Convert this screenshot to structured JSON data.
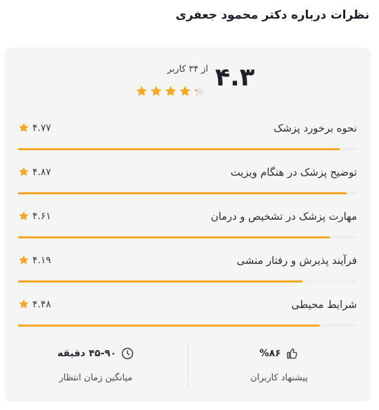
{
  "header": {
    "title": "نظرات درباره دکتر محمود جعفری"
  },
  "summary": {
    "average": "۴.۳",
    "count_text": "از ۳۴ کاربر",
    "rating_fraction": 0.86
  },
  "criteria": [
    {
      "label": "نحوه برخورد پزشک",
      "score": "۴.۷۷",
      "fill": 0.95
    },
    {
      "label": "توضیح پزشک در هنگام ویزیت",
      "score": "۴.۸۷",
      "fill": 0.97
    },
    {
      "label": "مهارت پزشک در تشخیص و درمان",
      "score": "۴.۶۱",
      "fill": 0.92
    },
    {
      "label": "فرآیند پذیرش و رفتار منشی",
      "score": "۴.۱۹",
      "fill": 0.84
    },
    {
      "label": "شرایط محیطی",
      "score": "۴.۴۸",
      "fill": 0.89
    }
  ],
  "stats": {
    "recommend_value": "%۸۶",
    "recommend_label": "پیشنهاد کاربران",
    "wait_value": "۴۵-۹۰ دقیقه",
    "wait_label": "میانگین زمان انتظار"
  },
  "icons": {
    "star": "star-icon",
    "thumb": "thumbs-up-icon",
    "clock": "clock-icon"
  },
  "colors": {
    "accent": "#f5a623",
    "card_bg": "#f5f5f6",
    "track": "#ececef",
    "empty_star": "#e3e3e6"
  }
}
